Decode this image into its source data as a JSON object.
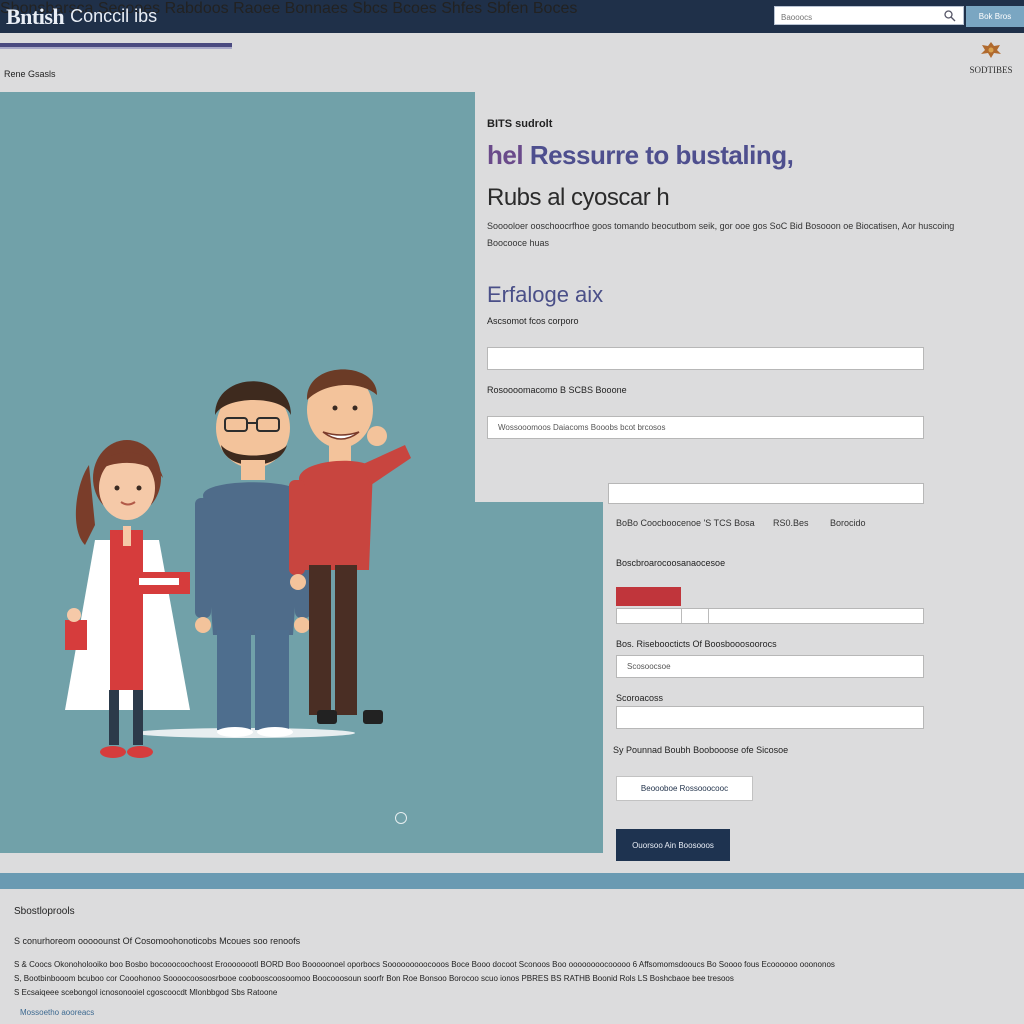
{
  "header": {
    "logo_main": "Bntish",
    "logo_sub": "Conccil ibs",
    "nav": [
      "Sbonsbarsca",
      "Secooes",
      "Rabdoos",
      "Raoee Bonnaes",
      "Sbcs",
      "Bcoes",
      "Shfes",
      "Sbfen Boces"
    ],
    "search_placeholder": "Baooocs",
    "search_button": "Bok Bros"
  },
  "breadcrumb": "Rene Gsasls",
  "brand_mark": "SODTIBES",
  "hero": {
    "eyebrow": "BITS sudrolt",
    "headline_first": "hel",
    "headline_rest": "Ressurre to bustaling,",
    "subhead": "Rubs al cyoscar h",
    "description": "Sooooloer ooschoocrfhoe goos tomando beocutbom seik, gor ooe gos SoC Bid Bosooon oe Biocatisen, Aor huscoing Boocooce huas"
  },
  "form": {
    "section_title": "Erfaloge aix",
    "label_1": "Ascsomot fcos corporo",
    "field_1": "",
    "label_2": "Rosoooomacomo B SCBS Booone",
    "field_2": "Wossooomoos Daiacoms Booobs bcot brcosos",
    "field_3": "",
    "row_a": "BoBo Coocboocenoe 'S TCS Bosa",
    "row_b": "RS0.Bes",
    "row_c": "Borocido",
    "label_4": "Boscbroarocoosanaocesoe",
    "field_4": "",
    "label_5": "Bos. Riseboocticts Of Boosbooosoorocs",
    "field_5": "Scosoocsoe",
    "label_6": "Scoroacoss",
    "field_6": "",
    "label_7": "Sy Pounnad Boubh Boobooose ofe Sicosoe",
    "btn_outline": "Beoooboe Rossooocooc",
    "btn_primary": "Ouorsoo Ain Boosooos"
  },
  "footer": {
    "title": "Sbostloprools",
    "line_1": "S conurhoreom ooooounst Of Cosomoohonoticobs Mcoues soo renoofs",
    "small_1": "S & Coocs Okonoholooiko boo Bosbo bocooocoochoost Eroooooootl BORD Boo Booooonoel oporbocs Sooooooooocooos Boce Booo docoot Sconoos Boo oooooooocooooo 6 Affsomomsdooucs Bo Soooo fous Ecoooooo ooononos",
    "small_2": "S, Bootbinbooom bcuboo cor Cooohonoo Soooocoosoosrbooe coobooscoosoomoo Boocooosoun soorfr Bon Roe Bonsoo Borocoo scuo ionos PBRES BS RATHB Boonid Rols LS Boshcbaoe bee tresoos",
    "small_3": "S Ecsaiqeee scebongol icnosonooiel cgoscoocdt Mlonbbgod Sbs Ratoone",
    "link": "Mossoetho aooreacs"
  }
}
